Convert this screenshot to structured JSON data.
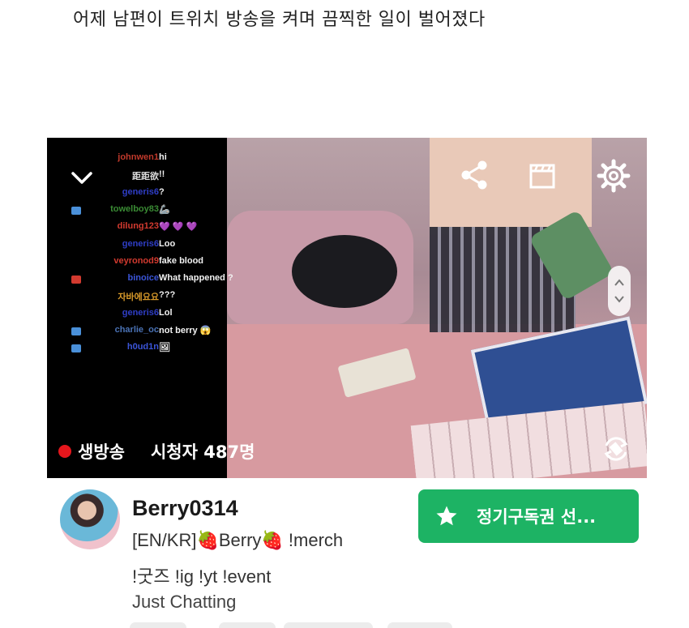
{
  "headline": "어제 남편이 트위치 방송을 켜며 끔찍한 일이 벌어졌다",
  "chat": [
    {
      "name": "johnwen1",
      "color": "#c0392b",
      "msg": "hi",
      "badge": ""
    },
    {
      "name": "距距欲",
      "color": "#dcdcdc",
      "msg": "!!",
      "badge": ""
    },
    {
      "name": "generis6",
      "color": "#2f3ec7",
      "msg": "?",
      "badge": ""
    },
    {
      "name": "towelboy83",
      "color": "#3a8b34",
      "msg": "",
      "badge": "#4a90d9",
      "emote": "🦾"
    },
    {
      "name": "dilung123",
      "color": "#d23a2f",
      "msg": "💜 💜 💜",
      "badge": ""
    },
    {
      "name": "generis6",
      "color": "#2f3ec7",
      "msg": "Loo",
      "badge": ""
    },
    {
      "name": "veyronod9",
      "color": "#d23a2f",
      "msg": "fake blood",
      "badge": ""
    },
    {
      "name": "binoice",
      "color": "#3b55d9",
      "msg": "What happened ?",
      "badge": "#d23a2f"
    },
    {
      "name": "자바에요요",
      "color": "#d89a2a",
      "msg": "???",
      "badge": ""
    },
    {
      "name": "generis6",
      "color": "#2f3ec7",
      "msg": "Lol",
      "badge": ""
    },
    {
      "name": "charlie_oc",
      "color": "#4a72b5",
      "msg": "not berry 😱",
      "badge": "#4a90d9"
    },
    {
      "name": "h0ud1n",
      "color": "#3b55d9",
      "msg": "",
      "badge": "#4a90d9",
      "emote": "🖼"
    }
  ],
  "player": {
    "live_label": "생방송",
    "viewers_label": "시청자 487명"
  },
  "channel": {
    "name": "Berry0314",
    "title_line1": "[EN/KR]🍓Berry🍓 !merch",
    "title_line2": "!굿즈 !ig !yt !event",
    "category": "Just Chatting",
    "subscribe_label": "정기구독권 선..."
  },
  "colors": {
    "accent_green": "#1db364",
    "live_red": "#e5161c"
  },
  "icons": [
    "chevron-down-icon",
    "share-icon",
    "clip-icon",
    "gear-icon",
    "rotate-icon",
    "star-icon"
  ]
}
